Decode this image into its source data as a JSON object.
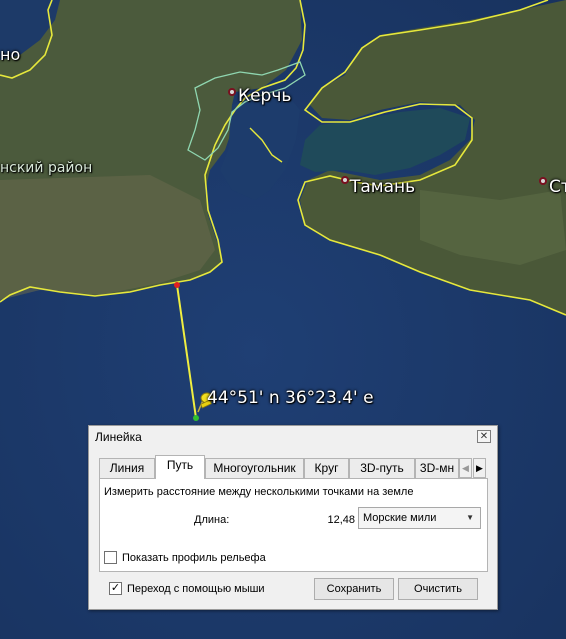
{
  "map": {
    "labels": {
      "left_edge": "но",
      "district": "нский район",
      "kerch": "Керчь",
      "taman": "Тамань",
      "right_edge": "Ст"
    },
    "placemark": {
      "coords": "44°51' n 36°23.4' e",
      "icon": "pushpin-icon"
    },
    "colors": {
      "sea": "#1c3a68",
      "land": "#3f5236",
      "border_line": "#e6e83c",
      "city_boundary": "#8fd6b0",
      "ruler_line": "#f0ee40"
    }
  },
  "dialog": {
    "title": "Линейка",
    "close_icon": "close-icon",
    "tabs": [
      {
        "label": "Линия"
      },
      {
        "label": "Путь"
      },
      {
        "label": "Многоугольник"
      },
      {
        "label": "Круг"
      },
      {
        "label": "3D-путь"
      },
      {
        "label": "3D-мн"
      }
    ],
    "active_tab": "Путь",
    "description": "Измерить расстояние между несколькими точками на земле",
    "length_label": "Длина:",
    "length_value": "12,48",
    "unit_selected": "Морские мили",
    "terrain_profile_label": "Показать профиль рельефа",
    "terrain_profile_checked": false,
    "mouse_navigation_label": "Переход с помощью мыши",
    "mouse_navigation_checked": true,
    "save_label": "Сохранить",
    "clear_label": "Очистить"
  }
}
